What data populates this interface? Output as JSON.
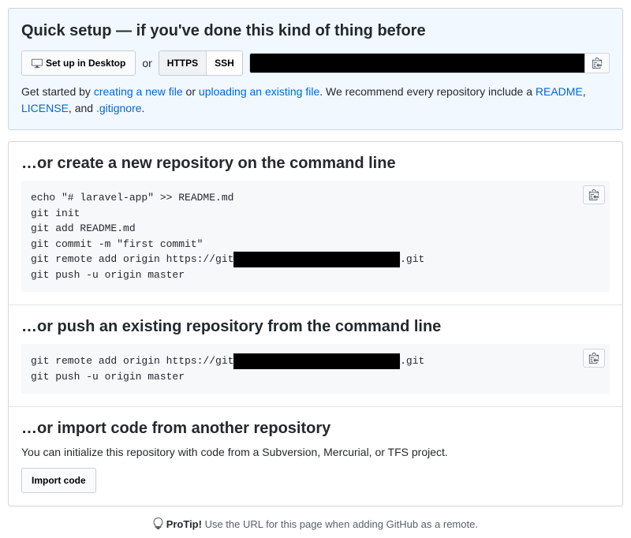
{
  "quicksetup": {
    "title": "Quick setup — if you've done this kind of thing before",
    "desktop_btn": "Set up in Desktop",
    "or": "or",
    "https": "HTTPS",
    "ssh": "SSH",
    "clone_url": "███████████████████████████████████████████████",
    "help_prefix": "Get started by ",
    "link_create": "creating a new file",
    "help_or": " or ",
    "link_upload": "uploading an existing file",
    "help_mid": ". We recommend every repository include a ",
    "link_readme": "README",
    "comma1": ", ",
    "link_license": "LICENSE",
    "comma2": ", and ",
    "link_gitignore": ".gitignore",
    "period": "."
  },
  "create": {
    "title": "…or create a new repository on the command line",
    "line1": "echo \"# laravel-app\" >> README.md",
    "line2": "git init",
    "line3": "git add README.md",
    "line4": "git commit -m \"first commit\"",
    "line5a": "git remote add origin https://git",
    "line5_redact": "███████████████████████████",
    "line5b": ".git",
    "line6": "git push -u origin master"
  },
  "push": {
    "title": "…or push an existing repository from the command line",
    "line1a": "git remote add origin https://git",
    "line1_redact": "███████████████████████████",
    "line1b": ".git",
    "line2": "git push -u origin master"
  },
  "import": {
    "title": "…or import code from another repository",
    "desc": "You can initialize this repository with code from a Subversion, Mercurial, or TFS project.",
    "btn": "Import code"
  },
  "protip": {
    "label": "ProTip!",
    "text": " Use the URL for this page when adding GitHub as a remote."
  }
}
